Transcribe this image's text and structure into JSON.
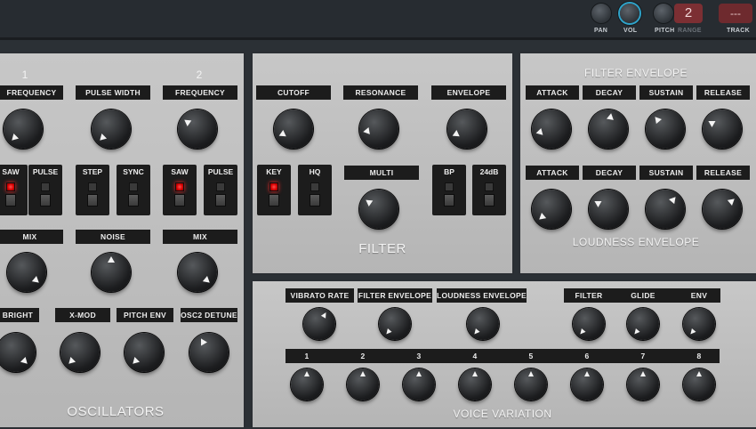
{
  "topbar": {
    "pan": "PAN",
    "vol": "VOL",
    "pitch": "PITCH",
    "range": "RANGE",
    "range_value": "2",
    "track": "TRACK",
    "track_value": "---"
  },
  "osc": {
    "num1": "1",
    "num2": "2",
    "frequency1": "FREQUENCY",
    "pulse_width": "PULSE WIDTH",
    "frequency2": "FREQUENCY",
    "saw1": "SAW",
    "pulse1": "PULSE",
    "step": "STEP",
    "sync": "SYNC",
    "saw2": "SAW",
    "pulse2": "PULSE",
    "mix1": "MIX",
    "noise": "NOISE",
    "mix2": "MIX",
    "bright": "BRIGHT",
    "xmod": "X-MOD",
    "pitch_env": "PITCH ENV",
    "osc2_detune": "OSC2 DETUNE",
    "title": "OSCILLATORS"
  },
  "filter": {
    "cutoff": "CUTOFF",
    "resonance": "RESONANCE",
    "envelope": "ENVELOPE",
    "key": "KEY",
    "hq": "HQ",
    "multi": "MULTI",
    "bp": "BP",
    "db24": "24dB",
    "title": "FILTER"
  },
  "envelopes": {
    "filter_title": "FILTER ENVELOPE",
    "loudness_title": "LOUDNESS ENVELOPE",
    "f_attack": "ATTACK",
    "f_decay": "DECAY",
    "f_sustain": "SUSTAIN",
    "f_release": "RELEASE",
    "l_attack": "ATTACK",
    "l_decay": "DECAY",
    "l_sustain": "SUSTAIN",
    "l_release": "RELEASE"
  },
  "voice": {
    "vibrato_rate": "VIBRATO RATE",
    "filter_envelope": "FILTER ENVELOPE",
    "loudness_envelope": "LOUDNESS ENVELOPE",
    "filter": "FILTER",
    "glide": "GLIDE",
    "env": "ENV",
    "voices": [
      "1",
      "2",
      "3",
      "4",
      "5",
      "6",
      "7",
      "8"
    ],
    "title": "VOICE VARIATION"
  },
  "colors": {
    "led_on": "#ff2a2a",
    "accent_vol": "#2fa3c9",
    "range_box": "#7c2f33"
  }
}
